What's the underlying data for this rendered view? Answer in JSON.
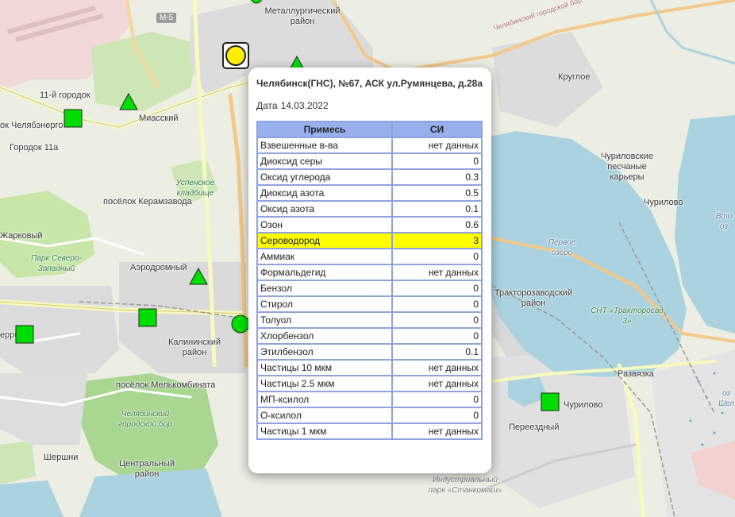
{
  "map": {
    "labels": {
      "metallurg": "Металлургический район",
      "gorodok11": "11-й городок",
      "chelyabenergo": "ок Челябэнерго",
      "miassky": "Миасский",
      "gorodok11a": "Городок 11а",
      "uspenskoe": "Успенское кладбище",
      "keramzavod": "посёлок Керамзавода",
      "zharkovy": "Жарковый",
      "park_severo": "Парк Северо-Западный",
      "aerodromny": "Аэродромный",
      "kalininsky": "Калининский район",
      "melkombinat": "посёлок Мелькомбината",
      "gorodskoy_bor": "Челябинский городской бор",
      "tsentralny": "Центральный район",
      "shershni": "Шершни",
      "kurchi": "ерри",
      "kruglo": "Круглое",
      "churilovskie": "Чуриловские песчаные карьеры",
      "churilovo": "Чурилово",
      "churilovo2": "Чурилово",
      "pervoe_ozero": "Первое озеро",
      "traktorozavodsky": "Тракторозаводский район",
      "snt": "СНТ «Трактороcад 3»",
      "razvyazka": "Развязка",
      "pereezdny": "Переездный",
      "industrial_park": "Индустриальный парк «Станкомаш»",
      "vto": "Вто оз",
      "oz_shel": "оз Шел",
      "road_gorod": "Челябинский городской бор",
      "m5": "М-5"
    }
  },
  "popup": {
    "title": "Челябинск(ГНС), №67, АСК ул.Румянцева, д.28а",
    "date_label": "Дата",
    "date_value": "14.03.2022",
    "columns": {
      "name": "Примесь",
      "value": "СИ"
    },
    "rows": [
      {
        "name": "Взвешенные в-ва",
        "value": "нет данных"
      },
      {
        "name": "Диоксид серы",
        "value": "0"
      },
      {
        "name": "Оксид углерода",
        "value": "0.3"
      },
      {
        "name": "Диоксид азота",
        "value": "0.5"
      },
      {
        "name": "Оксид азота",
        "value": "0.1"
      },
      {
        "name": "Озон",
        "value": "0.6"
      },
      {
        "name": "Сероводород",
        "value": "3"
      },
      {
        "name": "Аммиак",
        "value": "0"
      },
      {
        "name": "Формальдегид",
        "value": "нет данных"
      },
      {
        "name": "Бензол",
        "value": "0"
      },
      {
        "name": "Стирол",
        "value": "0"
      },
      {
        "name": "Толуол",
        "value": "0"
      },
      {
        "name": "Хлорбензол",
        "value": "0"
      },
      {
        "name": "Этилбензол",
        "value": "0.1"
      },
      {
        "name": "Частицы 10 мкм",
        "value": "нет данных"
      },
      {
        "name": "Частицы 2.5 мкм",
        "value": "нет данных"
      },
      {
        "name": "МП-ксилол",
        "value": "0"
      },
      {
        "name": "О-ксилол",
        "value": "0"
      },
      {
        "name": "Частицы 1 мкм",
        "value": "нет данных"
      }
    ],
    "highlight_color": "#ffff00"
  },
  "colors": {
    "marker_green": "#00e000",
    "marker_yellow": "#ffee00",
    "water": "#aad3df",
    "park": "#c8e6a8",
    "header": "#99b0ef"
  }
}
